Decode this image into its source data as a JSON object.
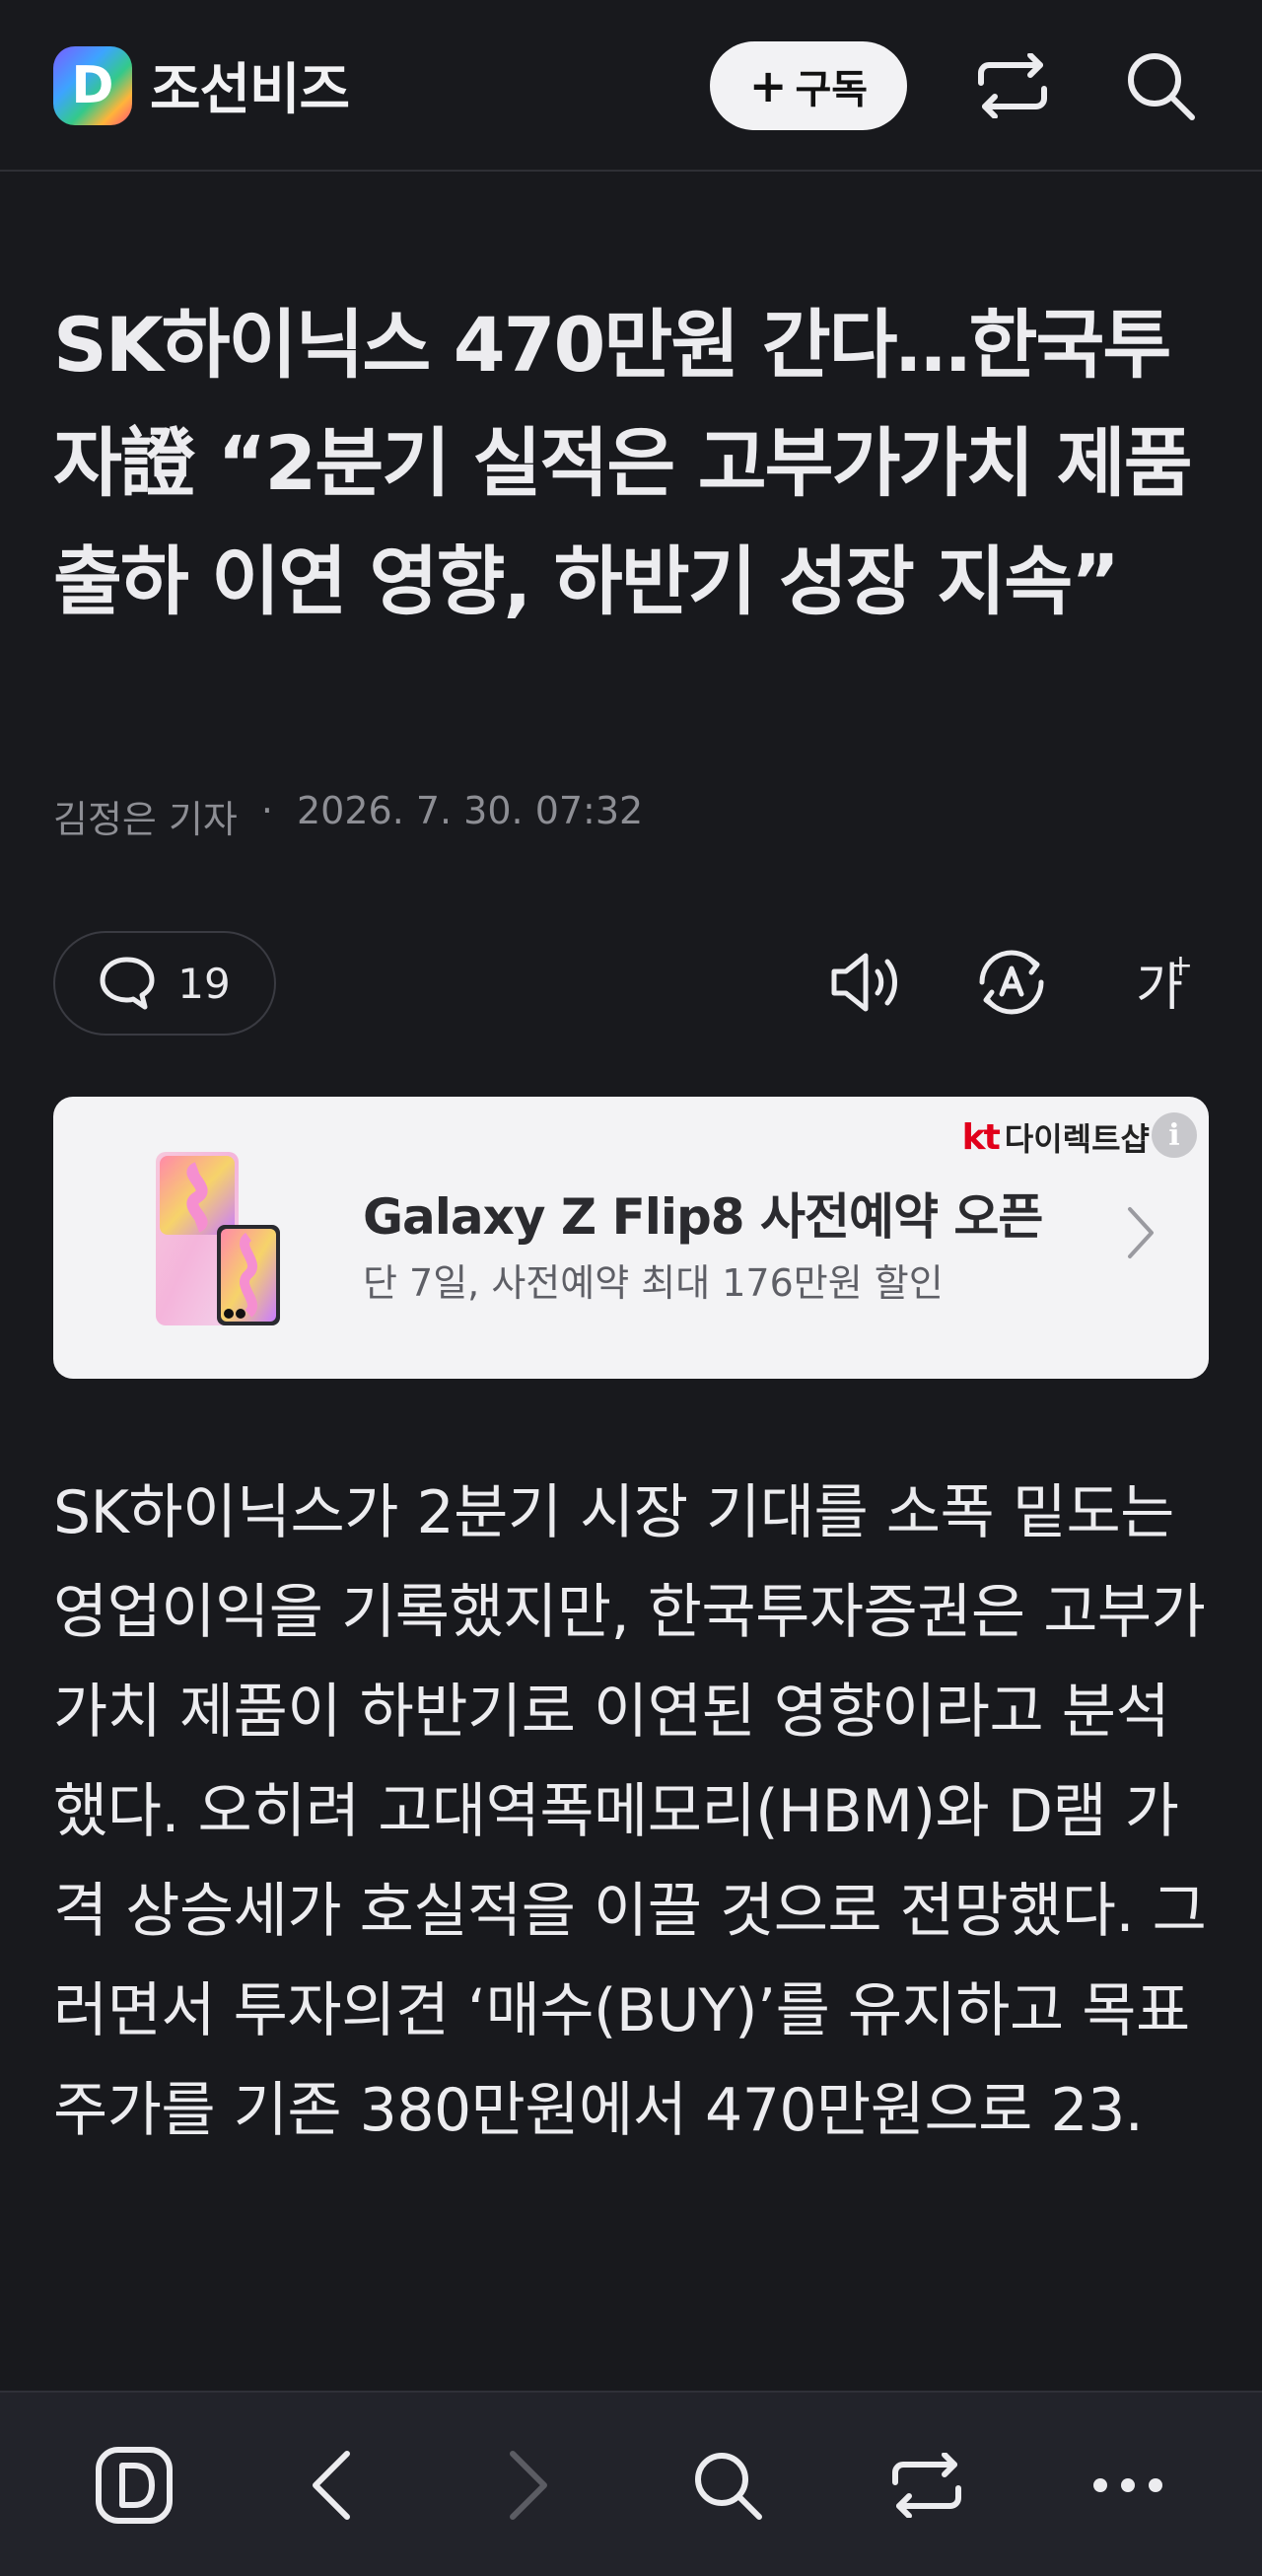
{
  "header": {
    "logo_letter": "D",
    "logo_text": "조선비즈",
    "subscribe_label": "구독",
    "icons": [
      "share-icon",
      "search-icon"
    ]
  },
  "article": {
    "headline": "SK하이닉스 470만원 간다…한국투자證 “2분기 실적은 고부가가치 제품 출하 이연 영향, 하반기 성장 지속”",
    "author": "김정은 기자",
    "datetime": "2026. 7. 30. 07:32",
    "comment_count": "19",
    "actions": [
      "speaker-icon",
      "auto-translate-icon",
      "font-size-icon"
    ],
    "font_size_label": "가",
    "body": "SK하이닉스가 2분기 시장 기대를 소폭 밑도는 영업이익을 기록했지만, 한국투자증권은 고부가가치 제품이 하반기로 이연된 영향이라고 분석했다. 오히려 고대역폭메모리(HBM)와 D램 가격 상승세가 호실적을 이끌 것으로 전망했다. 그러면서 투자의견 ‘매수(BUY)’를 유지하고 목표 주가를 기존 380만원에서 470만원으로 23."
  },
  "ad": {
    "brand_prefix": "kt",
    "brand_name": "다이렉트샵",
    "info_label": "i",
    "title": "Galaxy Z Flip8 사전예약 오픈",
    "subtitle": "단 7일, 사전예약 최대 176만원 할인"
  },
  "bottom_nav": {
    "items": [
      "home-d-icon",
      "back-icon",
      "forward-icon",
      "search-icon",
      "share-icon",
      "more-icon"
    ]
  },
  "colors": {
    "background": "#18191d",
    "text": "#ececef",
    "muted": "#8d8e94",
    "ad_background": "#f3f3f5",
    "kt_red": "#e1001b"
  }
}
